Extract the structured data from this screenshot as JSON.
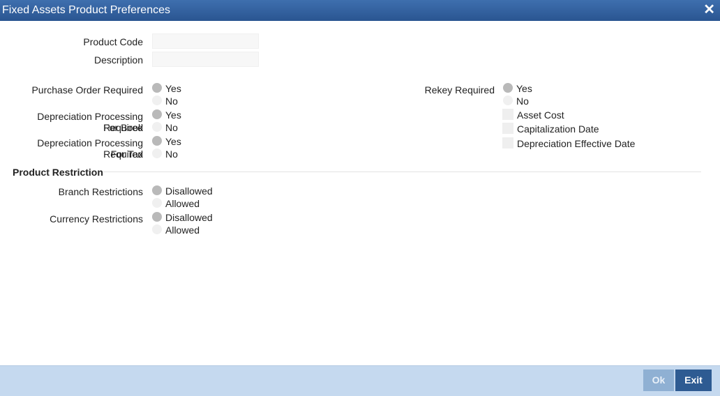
{
  "window": {
    "title": "Fixed Assets Product Preferences",
    "close_glyph": "✕"
  },
  "fields": {
    "product_code": {
      "label": "Product Code",
      "value": ""
    },
    "description": {
      "label": "Description",
      "value": ""
    }
  },
  "purchase_order_required": {
    "label": "Purchase Order Required",
    "options": [
      "Yes",
      "No"
    ],
    "selected": "Yes"
  },
  "depreciation_book": {
    "label_line1": "Depreciation Processing Required",
    "label_line2": "For Book",
    "options": [
      "Yes",
      "No"
    ],
    "selected": "Yes"
  },
  "depreciation_tax": {
    "label_line1": "Depreciation Processing Required",
    "label_line2": "For Tax",
    "options": [
      "Yes",
      "No"
    ],
    "selected": "Yes"
  },
  "rekey_required": {
    "label": "Rekey Required",
    "options": [
      "Yes",
      "No"
    ],
    "selected": "Yes",
    "checkboxes": [
      "Asset Cost",
      "Capitalization Date",
      "Depreciation Effective Date"
    ]
  },
  "product_restriction": {
    "title": "Product Restriction",
    "branch": {
      "label": "Branch Restrictions",
      "options": [
        "Disallowed",
        "Allowed"
      ],
      "selected": "Disallowed"
    },
    "currency": {
      "label": "Currency Restrictions",
      "options": [
        "Disallowed",
        "Allowed"
      ],
      "selected": "Disallowed"
    }
  },
  "footer": {
    "ok_label": "Ok",
    "exit_label": "Exit"
  }
}
